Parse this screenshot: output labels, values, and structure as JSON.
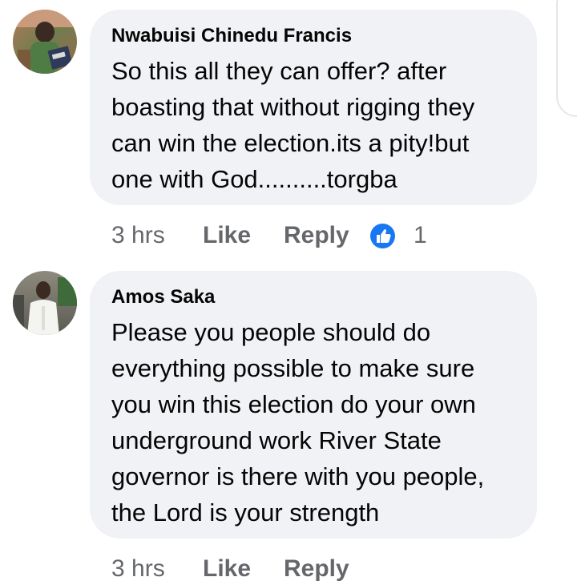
{
  "colors": {
    "bubble_background": "#f0f2f5",
    "author_text": "#050505",
    "meta_text": "#65676b",
    "like_reaction_blue": "#1877f2"
  },
  "comments": [
    {
      "author": "Nwabuisi Chinedu Francis",
      "text": "So this all they can offer? after\nboasting that without rigging they\ncan win the election.its a pity!but\none with God..........torgba",
      "time": "3 hrs",
      "like_label": "Like",
      "reply_label": "Reply",
      "reaction_icon": "thumbs-up-icon",
      "reaction_count": "1"
    },
    {
      "author": "Amos Saka",
      "text": "Please you people should do\neverything possible to make sure\nyou win this election do your own\nunderground work River State\ngovernor is there with you people,\nthe Lord is your strength",
      "time": "3 hrs",
      "like_label": "Like",
      "reply_label": "Reply"
    }
  ]
}
